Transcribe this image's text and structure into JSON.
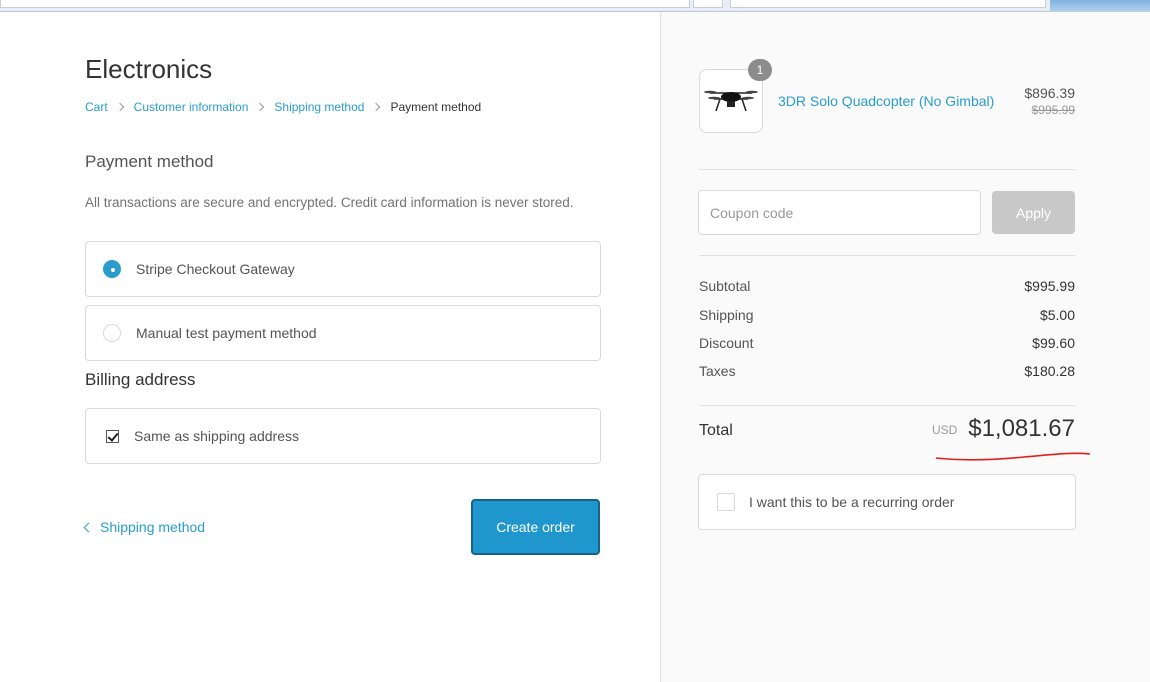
{
  "store": {
    "title": "Electronics"
  },
  "breadcrumb": {
    "items": [
      "Cart",
      "Customer information",
      "Shipping method",
      "Payment method"
    ]
  },
  "payment": {
    "title": "Payment method",
    "description": "All transactions are secure and encrypted. Credit card information is never stored.",
    "options": [
      {
        "label": "Stripe Checkout Gateway",
        "selected": true
      },
      {
        "label": "Manual test payment method",
        "selected": false
      }
    ]
  },
  "billing": {
    "title": "Billing address",
    "same_as_shipping_label": "Same as shipping address",
    "same_as_shipping_checked": true
  },
  "actions": {
    "back_label": "Shipping method",
    "create_order_label": "Create order"
  },
  "order": {
    "product": {
      "name": "3DR Solo Quadcopter (No Gimbal)",
      "quantity": "1",
      "price": "$896.39",
      "compare_at_price": "$995.99"
    },
    "coupon": {
      "placeholder": "Coupon code",
      "apply_label": "Apply"
    },
    "summary": [
      {
        "label": "Subtotal",
        "value": "$995.99"
      },
      {
        "label": "Shipping",
        "value": "$5.00"
      },
      {
        "label": "Discount",
        "value": "$99.60"
      },
      {
        "label": "Taxes",
        "value": "$180.28"
      }
    ],
    "total": {
      "label": "Total",
      "currency": "USD",
      "amount": "$1,081.67"
    },
    "recurring_label": "I want this to be a recurring order"
  },
  "colors": {
    "accent": "#2a9dcc",
    "button": "#1f96cd",
    "annotation": "#e0201c"
  }
}
